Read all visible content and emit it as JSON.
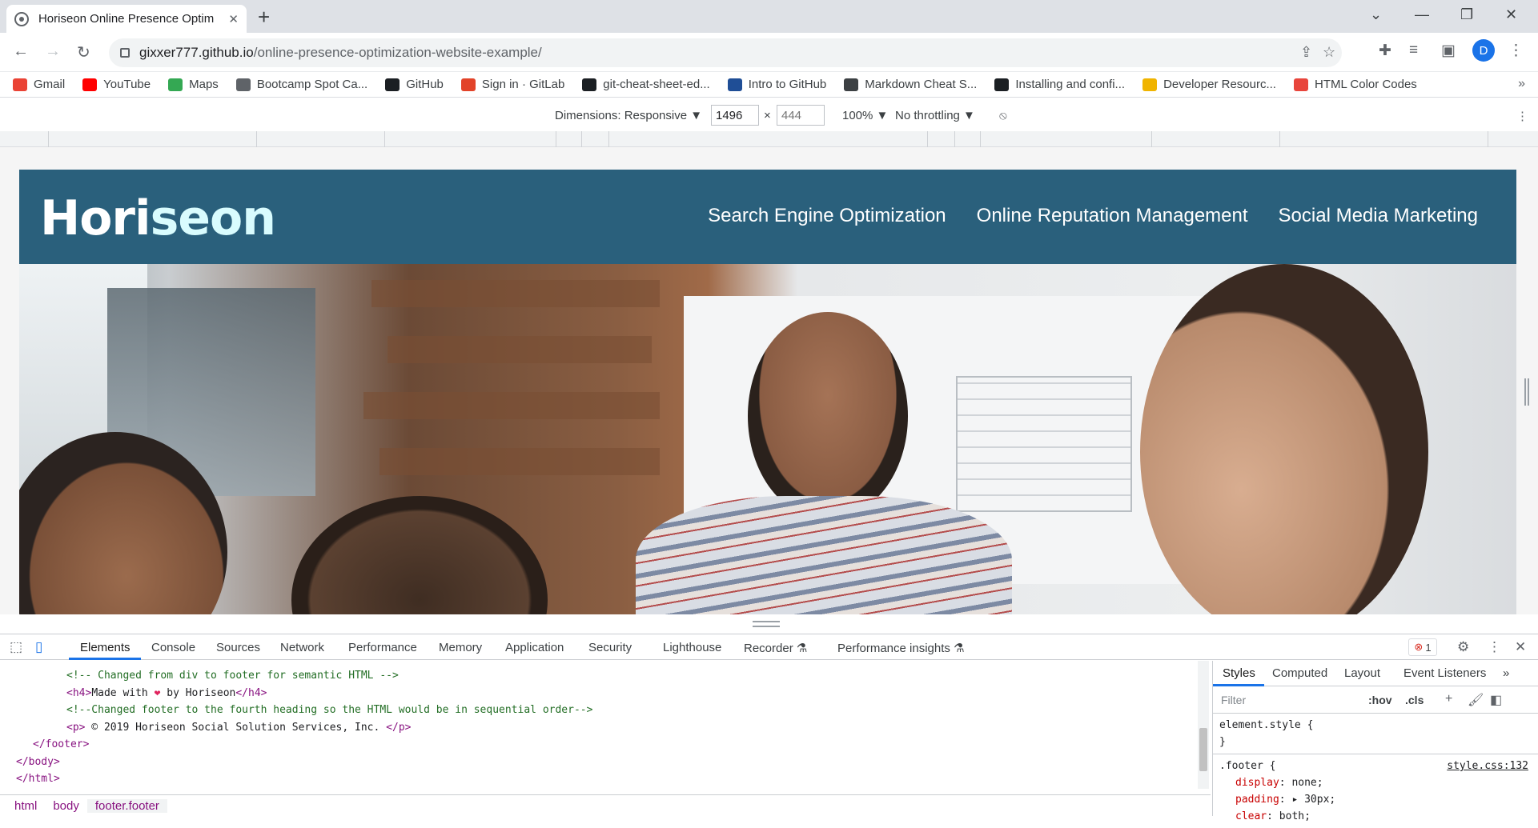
{
  "browser": {
    "tab_title": "Horiseon Online Presence Optim",
    "url_host": "gixxer777.github.io",
    "url_path": "/online-presence-optimization-website-example/",
    "profile_initial": "D"
  },
  "bookmarks": [
    {
      "label": "Gmail",
      "icon": "gmail-icon",
      "color": "#ea4335"
    },
    {
      "label": "YouTube",
      "icon": "youtube-icon",
      "color": "#ff0000"
    },
    {
      "label": "Maps",
      "icon": "maps-icon",
      "color": "#34a853"
    },
    {
      "label": "Bootcamp Spot Ca...",
      "icon": "globe-icon",
      "color": "#5f6368"
    },
    {
      "label": "GitHub",
      "icon": "github-icon",
      "color": "#1b1f23"
    },
    {
      "label": "Sign in · GitLab",
      "icon": "gitlab-icon",
      "color": "#e24329"
    },
    {
      "label": "git-cheat-sheet-ed...",
      "icon": "github-icon",
      "color": "#1b1f23"
    },
    {
      "label": "Intro to GitHub",
      "icon": "gsa-icon",
      "color": "#1f4e96"
    },
    {
      "label": "Markdown Cheat S...",
      "icon": "markdown-icon",
      "color": "#3c4043"
    },
    {
      "label": "Installing and confi...",
      "icon": "github-icon",
      "color": "#1b1f23"
    },
    {
      "label": "Developer Resourc...",
      "icon": "fs-icon",
      "color": "#f0b400"
    },
    {
      "label": "HTML Color Codes",
      "icon": "colorcodes-icon",
      "color": "#e8453c"
    }
  ],
  "device_toolbar": {
    "dimensions_label": "Dimensions: Responsive ▼",
    "width": "1496",
    "height_placeholder": "444",
    "times": "×",
    "zoom": "100% ▼",
    "throttling": "No throttling ▼"
  },
  "site": {
    "logo_hori": "Hori",
    "logo_seon": "seon",
    "nav": [
      "Search Engine Optimization",
      "Online Reputation Management",
      "Social Media Marketing"
    ],
    "colors": {
      "header": "#2a607c",
      "logo_accent": "#d9fcfe"
    }
  },
  "devtools": {
    "tabs": [
      "Elements",
      "Console",
      "Sources",
      "Network",
      "Performance",
      "Memory",
      "Application",
      "Security",
      "Lighthouse",
      "Recorder ⚗",
      "Performance insights ⚗"
    ],
    "error_count": "1",
    "code_lines": [
      {
        "indent": "   ",
        "cls": "c-com",
        "text": "<!-- Changed from div to footer for semantic HTML -->"
      },
      {
        "indent": "   ",
        "cls": "c-tag",
        "pre": "<h4>",
        "mid": "Made with ",
        "heart": "❤",
        "post_txt": " by Horiseon",
        "close": "</h4>"
      },
      {
        "indent": "   ",
        "cls": "c-com",
        "text": "<!--Changed footer to the fourth heading so the HTML would be in sequential order-->"
      },
      {
        "indent": "   ",
        "cls": "c-tag",
        "pre": "<p>",
        "mid": " © 2019 Horiseon Social Solution Services, Inc. ",
        "close": "</p>"
      },
      {
        "indent": " ",
        "cls": "c-tag",
        "text": "</footer>"
      },
      {
        "indent": "",
        "cls": "c-tag",
        "text": "</body>"
      },
      {
        "indent": "",
        "cls": "c-tag",
        "text": "</html>"
      }
    ],
    "breadcrumbs": [
      "html",
      "body",
      "footer.footer"
    ],
    "styles_tabs": [
      "Styles",
      "Computed",
      "Layout",
      "Event Listeners",
      "»"
    ],
    "filter_placeholder": "Filter",
    "hov": ":hov",
    "cls": ".cls",
    "element_style": "element.style {",
    "close_brace": "}",
    "footer_rule": ".footer {",
    "footer_source": "style.css:132",
    "props": [
      {
        "name": "display",
        "value": "none;"
      },
      {
        "name": "padding",
        "value": "▸ 30px;"
      },
      {
        "name": "clear",
        "value": "both;"
      }
    ]
  }
}
